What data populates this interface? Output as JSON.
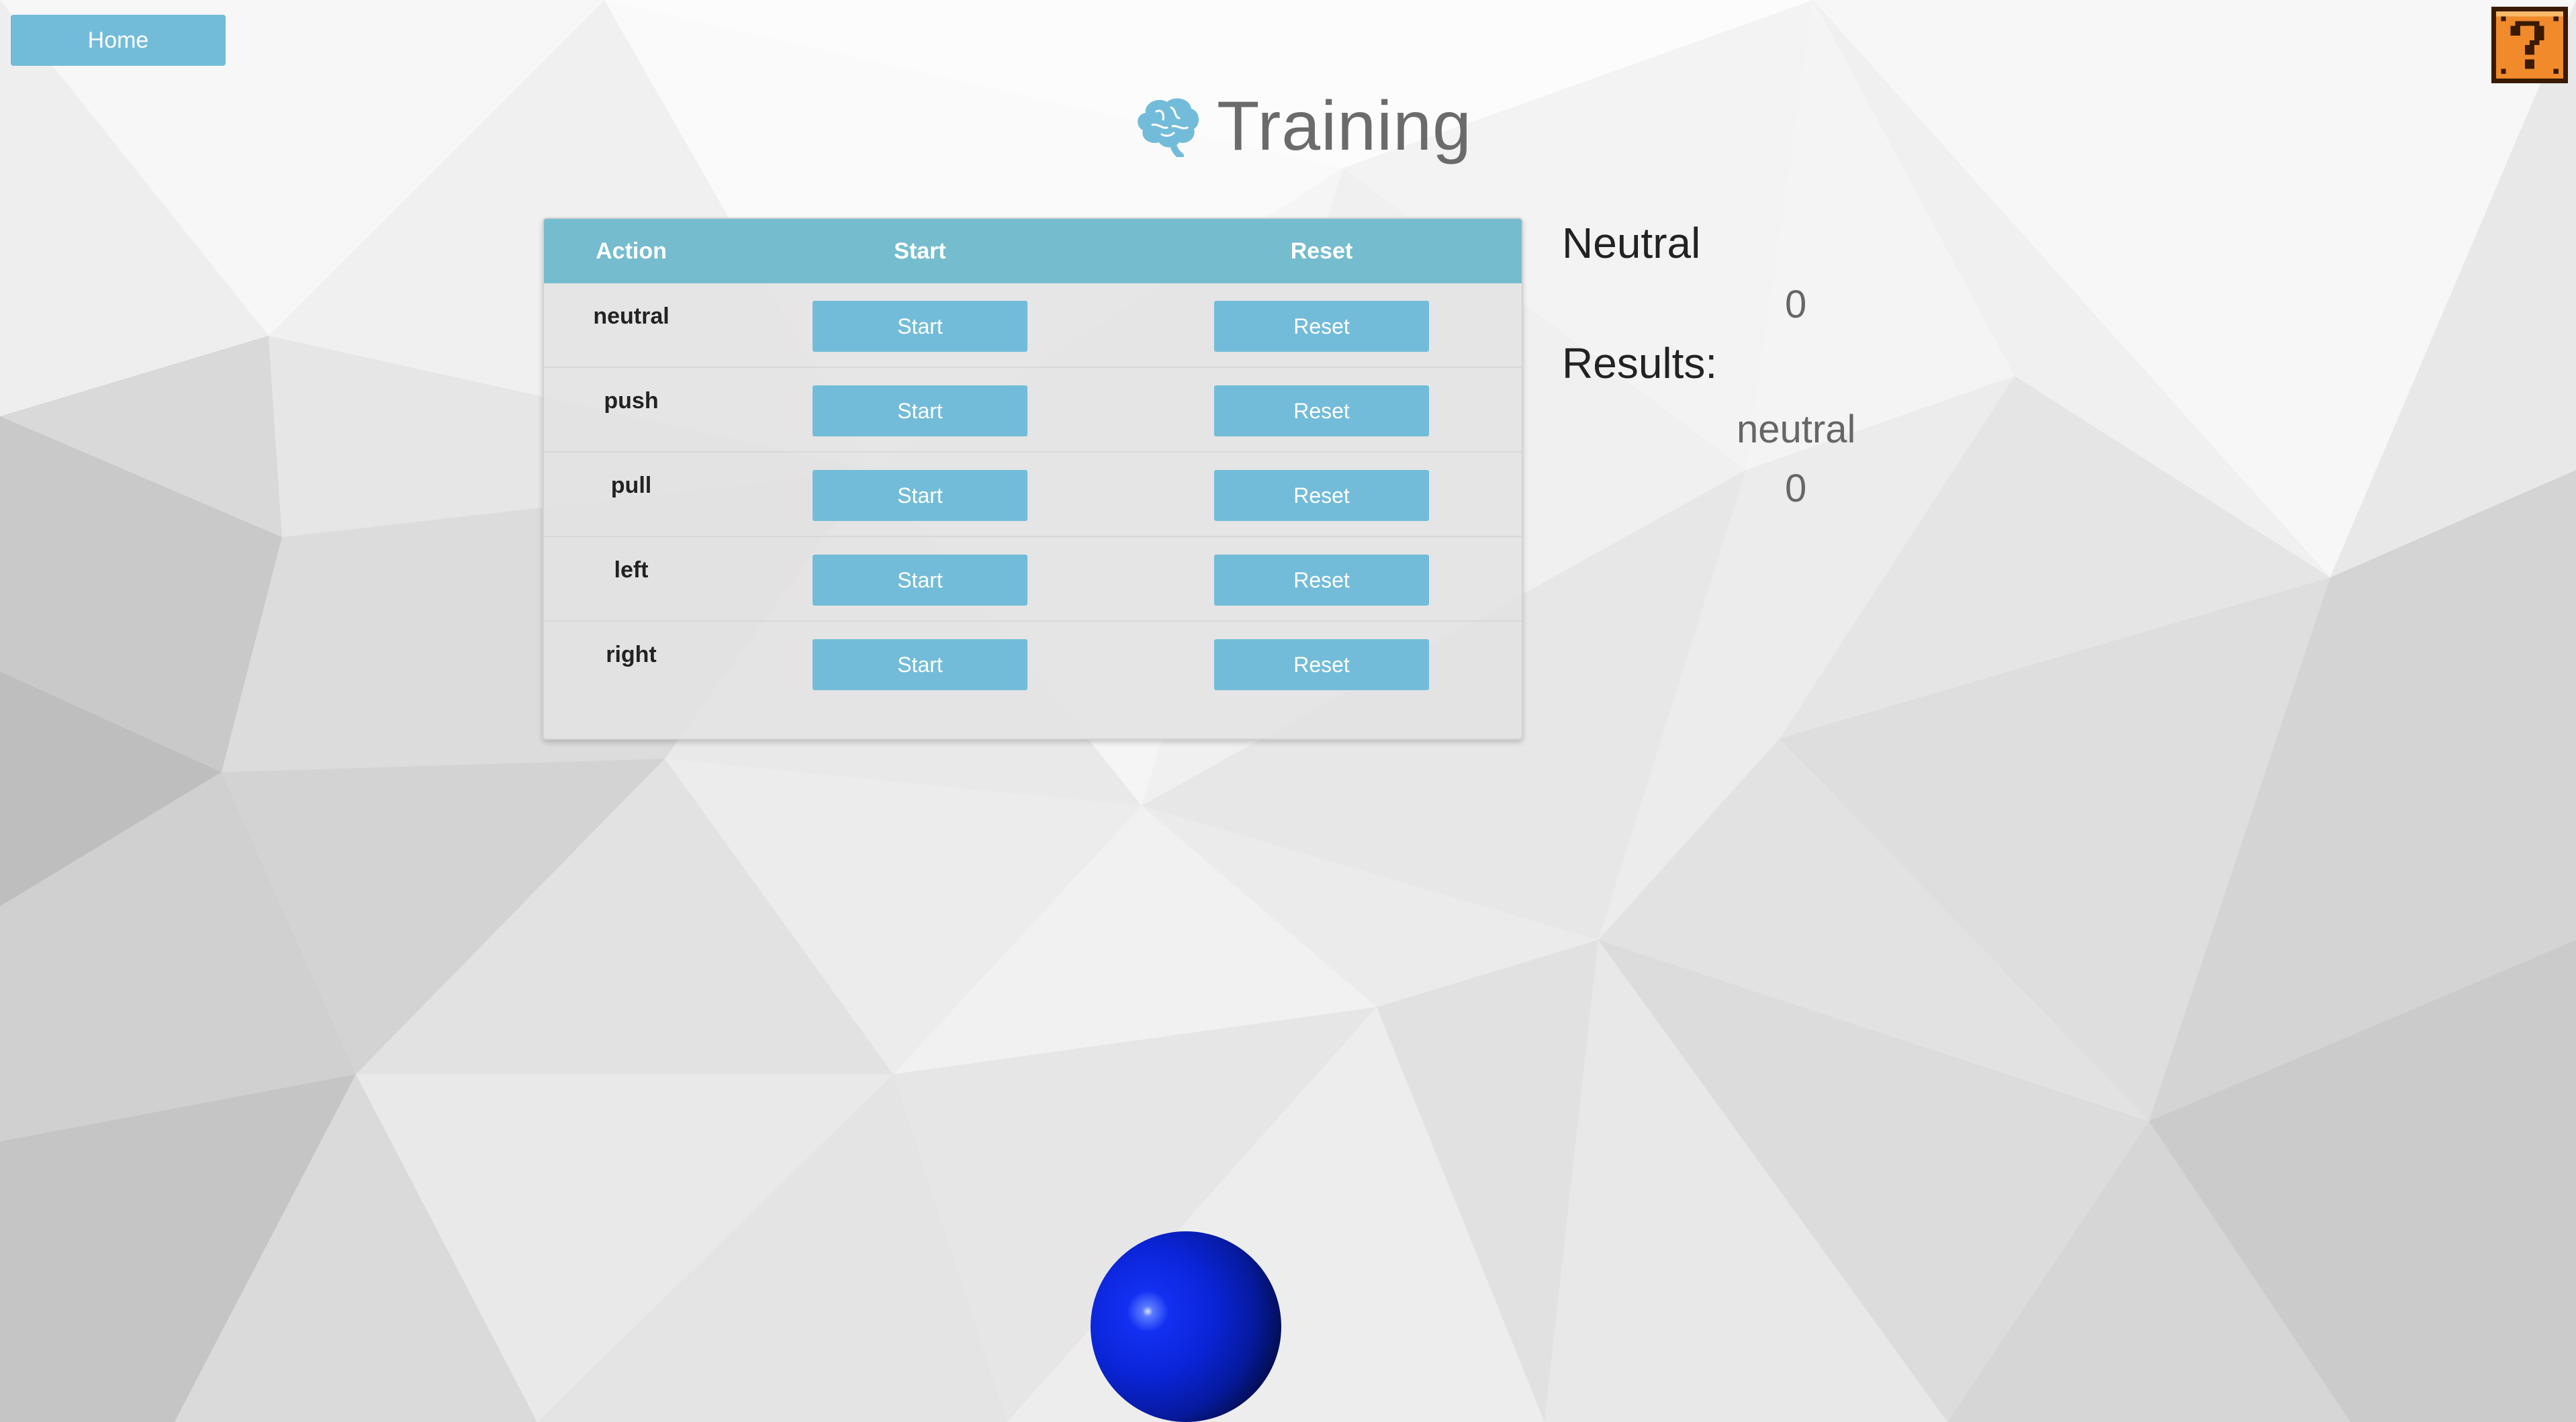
{
  "nav": {
    "home_label": "Home",
    "help_icon": "question-block-icon"
  },
  "header": {
    "title": "Training",
    "icon": "brain-icon"
  },
  "table": {
    "columns": [
      "Action",
      "Start",
      "Reset"
    ],
    "rows": [
      {
        "action": "neutral",
        "start_label": "Start",
        "reset_label": "Reset"
      },
      {
        "action": "push",
        "start_label": "Start",
        "reset_label": "Reset"
      },
      {
        "action": "pull",
        "start_label": "Start",
        "reset_label": "Reset"
      },
      {
        "action": "left",
        "start_label": "Start",
        "reset_label": "Reset"
      },
      {
        "action": "right",
        "start_label": "Start",
        "reset_label": "Reset"
      }
    ]
  },
  "status": {
    "current_action": "Neutral",
    "current_value": "0",
    "results_label": "Results:",
    "result_name": "neutral",
    "result_value": "0"
  },
  "colors": {
    "accent": "#72bcd9",
    "header": "#75bccf",
    "ball": "#0a24d6",
    "help_block": "#f08a2a"
  }
}
